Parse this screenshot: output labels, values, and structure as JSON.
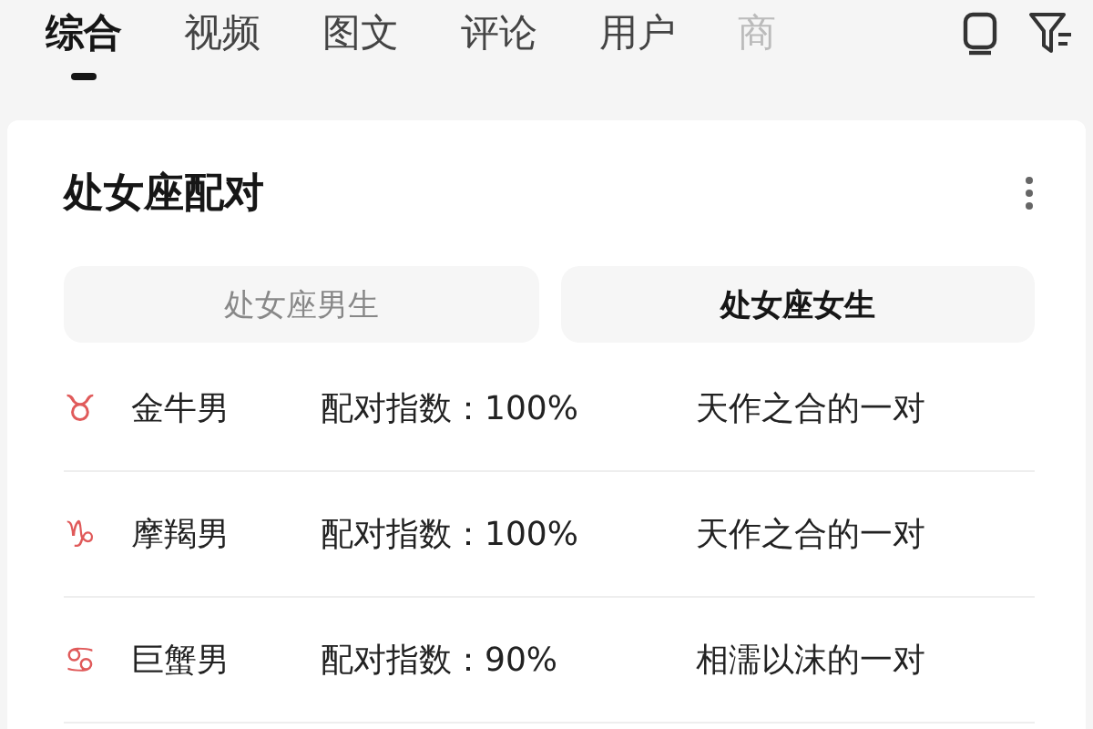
{
  "tabs": [
    {
      "label": "综合",
      "selected": true
    },
    {
      "label": "视频",
      "selected": false
    },
    {
      "label": "图文",
      "selected": false
    },
    {
      "label": "评论",
      "selected": false
    },
    {
      "label": "用户",
      "selected": false
    },
    {
      "label": "商",
      "selected": false
    }
  ],
  "card": {
    "title": "处女座配对",
    "segments": [
      {
        "label": "处女座男生",
        "selected": false
      },
      {
        "label": "处女座女生",
        "selected": true
      }
    ],
    "rows": [
      {
        "symbol": "♉",
        "sign": "金牛男",
        "score": "配对指数：100%",
        "verdict": "天作之合的一对"
      },
      {
        "symbol": "♑",
        "sign": "摩羯男",
        "score": "配对指数：100%",
        "verdict": "天作之合的一对"
      },
      {
        "symbol": "♋",
        "sign": "巨蟹男",
        "score": "配对指数：90%",
        "verdict": "相濡以沫的一对"
      }
    ]
  }
}
